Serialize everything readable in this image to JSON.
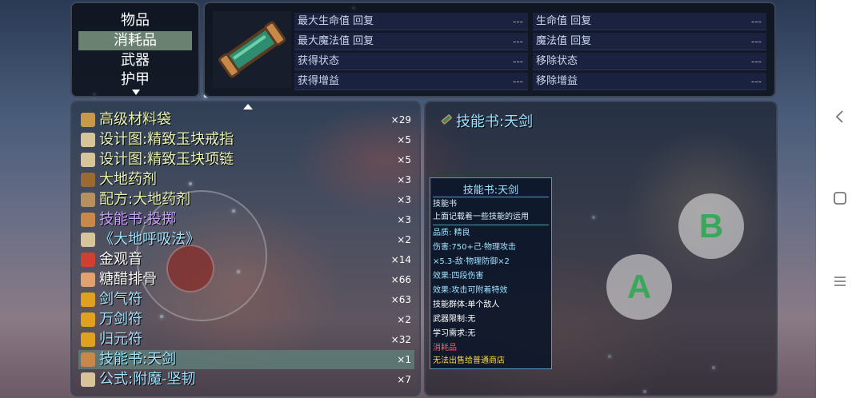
{
  "categories": {
    "items": [
      "物品",
      "消耗品",
      "武器",
      "护甲"
    ],
    "selected_index": 1
  },
  "stats": {
    "left": [
      {
        "label": "最大生命值 回复",
        "value": "---"
      },
      {
        "label": "最大魔法值 回复",
        "value": "---"
      },
      {
        "label": "获得状态",
        "value": "---"
      },
      {
        "label": "获得增益",
        "value": "---"
      }
    ],
    "right": [
      {
        "label": "生命值 回复",
        "value": "---"
      },
      {
        "label": "魔法值 回复",
        "value": "---"
      },
      {
        "label": "移除状态",
        "value": "---"
      },
      {
        "label": "移除增益",
        "value": "---"
      }
    ]
  },
  "item_list": [
    {
      "name": "高级材料袋",
      "count": "×29",
      "color": "#e9f3b0",
      "icon": "bag-icon"
    },
    {
      "name": "设计图:精致玉块戒指",
      "count": "×5",
      "color": "#e9f3b0",
      "icon": "scroll-icon"
    },
    {
      "name": "设计图:精致玉块项链",
      "count": "×5",
      "color": "#e9f3b0",
      "icon": "scroll-icon"
    },
    {
      "name": "大地药剂",
      "count": "×3",
      "color": "#e9f3b0",
      "icon": "potion-icon"
    },
    {
      "name": "配方:大地药剂",
      "count": "×3",
      "color": "#e9f3b0",
      "icon": "recipe-icon"
    },
    {
      "name": "技能书:投掷",
      "count": "×3",
      "color": "#c9a0ff",
      "icon": "skillbook-icon"
    },
    {
      "name": "《大地呼吸法》",
      "count": "×2",
      "color": "#9de3ff",
      "icon": "manual-icon"
    },
    {
      "name": "金观音",
      "count": "×14",
      "color": "#ffffff",
      "icon": "tea-icon"
    },
    {
      "name": "糖醋排骨",
      "count": "×66",
      "color": "#ffffff",
      "icon": "dish-icon"
    },
    {
      "name": "剑气符",
      "count": "×63",
      "color": "#9de3ff",
      "icon": "talisman-icon"
    },
    {
      "name": "万剑符",
      "count": "×2",
      "color": "#9de3ff",
      "icon": "talisman-icon"
    },
    {
      "name": "归元符",
      "count": "×32",
      "color": "#9de3ff",
      "icon": "talisman-icon"
    },
    {
      "name": "技能书:天剑",
      "count": "×1",
      "color": "#9de3ff",
      "icon": "skillbook-icon"
    },
    {
      "name": "公式:附魔-坚韧",
      "count": "×7",
      "color": "#9de3ff",
      "icon": "formula-icon"
    }
  ],
  "selected_item_index": 12,
  "detail": {
    "title": "技能书:天剑"
  },
  "tooltip": {
    "title": "技能书:天剑",
    "lines": [
      {
        "text": "技能书",
        "color": "#d8f0ff"
      },
      {
        "text": "上面记载着一些技能的运用",
        "color": "#d8f0ff"
      },
      {
        "text": "品质: 精良",
        "color": "#9de3ff"
      },
      {
        "text": "伤害:750+己·物理攻击",
        "color": "#9de3ff"
      },
      {
        "text": "×5.3-敌·物理防御×2",
        "color": "#9de3ff"
      },
      {
        "text": "效果:四段伤害",
        "color": "#9de3ff"
      },
      {
        "text": "效果:攻击可附着特效",
        "color": "#9de3ff"
      },
      {
        "text": "技能群体:单个敌人",
        "color": "#ffffff"
      },
      {
        "text": "武器限制:无",
        "color": "#ffffff"
      },
      {
        "text": "学习需求:无",
        "color": "#ffffff"
      },
      {
        "text": "消耗品",
        "color": "#ff6060"
      },
      {
        "text": "无法出售给普通商店",
        "color": "#ffd84a"
      }
    ]
  },
  "controls": {
    "button_a": "A",
    "button_b": "B"
  },
  "nav": {
    "back_icon": "back-icon",
    "home_icon": "home-icon",
    "menu_icon": "menu-icon"
  }
}
